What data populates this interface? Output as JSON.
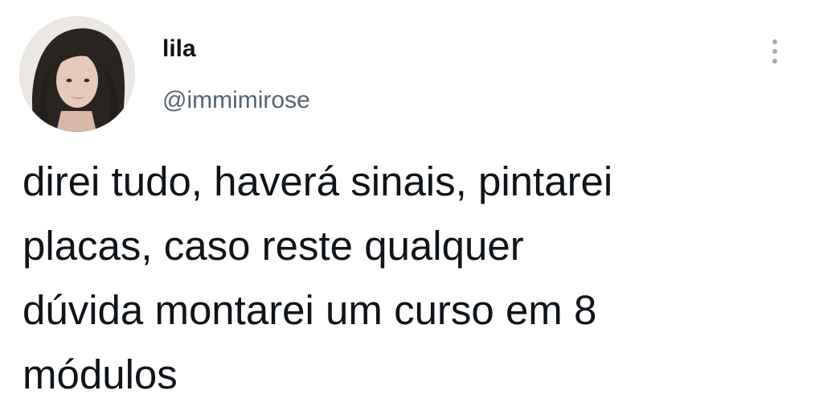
{
  "tweet": {
    "display_name": "lila",
    "handle": "@immimirose",
    "text": "direi tudo, haverá sinais, pintarei\nplacas, caso reste qualquer\ndúvida montarei um curso em 8\nmódulos",
    "avatar_icon": "profile-photo",
    "more_icon": "more-vertical-icon"
  },
  "colors": {
    "text_primary": "#0f1419",
    "text_secondary": "#536471",
    "background": "#ffffff"
  }
}
